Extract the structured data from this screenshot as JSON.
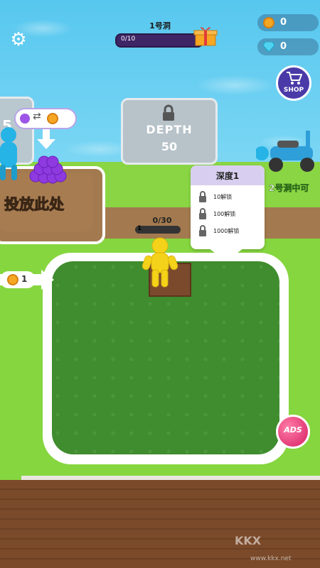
{
  "hud": {
    "level_title": "1号洞",
    "level_progress_text": "0/10",
    "level_progress": 0.0,
    "coins": "0",
    "gems": "0",
    "shop_label": "SHOP"
  },
  "depth_tile": {
    "label": "DEPTH",
    "value": "50"
  },
  "left_tile": {
    "number": "5"
  },
  "drop_zone": {
    "label": "投放此处"
  },
  "locked_area": {
    "label": "2号洞中可"
  },
  "unlock_card": {
    "title": "深度1",
    "rows": [
      {
        "text": "10解锁"
      },
      {
        "text": "100解锁"
      },
      {
        "text": "1000解锁"
      }
    ]
  },
  "player": {
    "capacity_text": "0/30",
    "bar_number": "1",
    "capacity": 0.0
  },
  "plot": {
    "cost": "1"
  },
  "ads_label": "ADS",
  "watermark": {
    "brand": "KKX",
    "url": "www.kkx.net"
  },
  "colors": {
    "water": "#57c7ef",
    "grass": "#86d63f",
    "field": "#3f8d2e",
    "dirt": "#a37a4f",
    "player": "#f5d21a",
    "purple_accent": "#6b42b5",
    "ads": "#d62064"
  }
}
